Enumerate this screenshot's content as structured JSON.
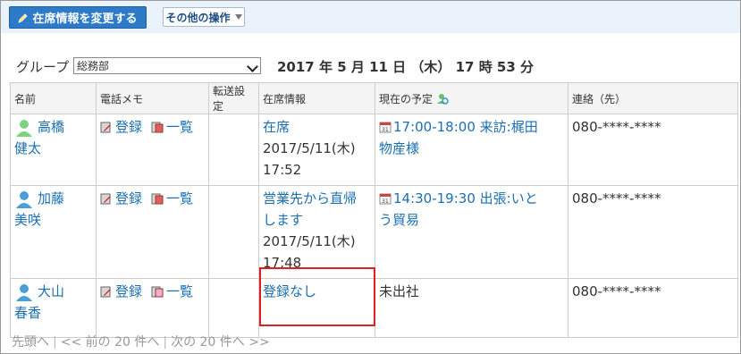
{
  "toolbar": {
    "primary_label": "在席情報を変更する",
    "other_label": "その他の操作"
  },
  "group": {
    "label": "グループ",
    "selected": "総務部"
  },
  "datetime": "2017 年 5 月 11 日 （木） 17 時 53 分",
  "table": {
    "headers": {
      "name": "名前",
      "memo": "電話メモ",
      "forward": "転送設定",
      "presence": "在席情報",
      "schedule": "現在の予定",
      "contact": "連絡（先）"
    },
    "memo_register": "登録",
    "memo_list": "一覧",
    "rows": [
      {
        "name_line1": "高橋",
        "name_line2": "健太",
        "presence_status": "在席",
        "presence_date": "2017/5/11(木)",
        "presence_time": "17:52",
        "schedule_line1": "17:00-18:00 来訪:梶田",
        "schedule_line2": "物産様",
        "contact": "080-****-****"
      },
      {
        "name_line1": "加藤",
        "name_line2": "美咲",
        "presence_status": "営業先から直帰",
        "presence_status2": "します",
        "presence_date": "2017/5/11(木)",
        "presence_time": "17:48",
        "schedule_line1": "14:30-19:30 出張:いと",
        "schedule_line2": "う貿易",
        "contact": "080-****-****"
      },
      {
        "name_line1": "大山",
        "name_line2": "春香",
        "presence_status": "登録なし",
        "schedule_text": "未出社",
        "contact": "080-****-****"
      }
    ]
  },
  "pager": {
    "first": "先頭へ",
    "prev": "<< 前の 20 件へ",
    "next": "次の 20 件へ >>"
  },
  "colors": {
    "primary_button": "#2d7bc8",
    "link": "#1a6fb3",
    "highlight": "#e02020"
  }
}
